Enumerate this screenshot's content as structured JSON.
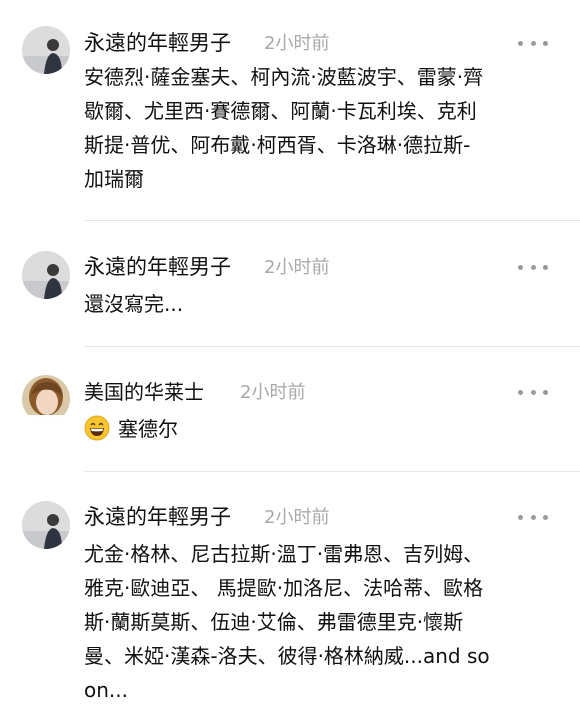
{
  "comments": [
    {
      "username": "永遠的年輕男子",
      "time": "2小时前",
      "lines": [
        "安德烈·薩金塞夫、柯內流·波藍波宇、雷蒙·齊",
        "歇爾、尤里西·賽德爾、阿蘭·卡瓦利埃、克利",
        "斯提·普优、阿布戴·柯西胥、卡洛琳·德拉斯-",
        "加瑞爾"
      ],
      "avatar": "young-man-avatar"
    },
    {
      "username": "永遠的年輕男子",
      "time": "2小时前",
      "lines": [
        "還沒寫完..."
      ],
      "avatar": "young-man-avatar"
    },
    {
      "username": "美国的华莱士",
      "time": "2小时前",
      "lines": [
        "塞德尔"
      ],
      "emoji": "grinning-face-emoji",
      "avatar": "wallace-avatar"
    },
    {
      "username": "永遠的年輕男子",
      "time": "2小时前",
      "lines": [
        "尤金·格林、尼古拉斯·溫丁·雷弗恩、吉列姆、",
        "雅克·歐迪亞、 馬提歐·加洛尼、法哈蒂、歐格",
        "斯·蘭斯莫斯、伍迪·艾倫、弗雷德里克·懷斯",
        "曼、米婭·漢森-洛夫、彼得·格林納威...and so",
        "on..."
      ],
      "avatar": "young-man-avatar"
    }
  ],
  "colors": {
    "username": "#111111",
    "time": "#a9a9a9",
    "divider": "#e6e6e6",
    "more_dots": "#9a9a9a"
  }
}
